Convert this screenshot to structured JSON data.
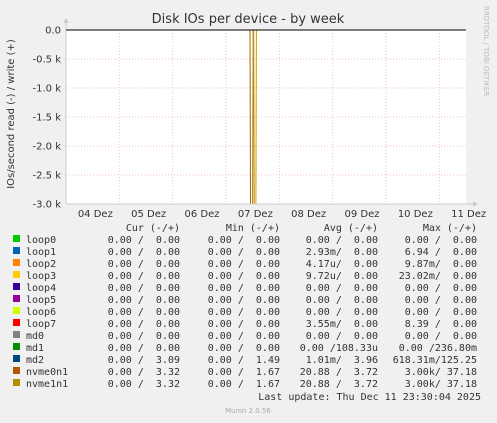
{
  "chart_data": {
    "type": "line",
    "title": "Disk IOs per device - by week",
    "ylabel": "IOs/second read (-) / write (+)",
    "side_label": "RRDTOOL / TOBI OETIKER",
    "ylim": [
      -3.0,
      0.2
    ],
    "yticks": [
      0.0,
      -0.5,
      -1.0,
      -1.5,
      -2.0,
      -2.5,
      -3.0
    ],
    "ytick_labels": [
      "0.0",
      "-0.5 k",
      "-1.0 k",
      "-1.5 k",
      "-2.0 k",
      "-2.5 k",
      "-3.0 k"
    ],
    "yunit": "k",
    "xlim": [
      0,
      7.5
    ],
    "xtick_positions": [
      1,
      2,
      3,
      4,
      5,
      6,
      7
    ],
    "xtick_labels": [
      "04 Dez",
      "05 Dez",
      "06 Dez",
      "07 Dez",
      "08 Dez",
      "09 Dez",
      "10 Dez",
      "11 Dez"
    ],
    "xlabel_days": [
      0.55,
      1.55,
      2.55,
      3.55,
      4.55,
      5.55,
      6.55,
      7.55
    ],
    "grid": true,
    "series": [
      {
        "name": "nvme0n1",
        "color": "#a46400",
        "x": [
          0,
          3.45,
          3.46,
          3.5,
          3.51,
          7.5
        ],
        "y": [
          0,
          0,
          -3.0,
          -3.0,
          0,
          0
        ]
      },
      {
        "name": "nvme1n1",
        "color": "#c8a000",
        "x": [
          0,
          3.52,
          3.53,
          3.56,
          3.57,
          7.5
        ],
        "y": [
          0,
          0,
          -3.0,
          -3.0,
          0,
          0
        ]
      },
      {
        "name": "md2",
        "color": "#000000",
        "x": [
          0,
          7.5
        ],
        "y": [
          0,
          0
        ]
      }
    ],
    "legend_header": {
      "cur": "Cur (-/+)",
      "min": "Min (-/+)",
      "avg": "Avg (-/+)",
      "max": "Max (-/+)"
    },
    "legend": [
      {
        "name": "loop0",
        "color": "#00cc00",
        "cur": "0.00 /  0.00",
        "min": "0.00 /  0.00",
        "avg": "0.00 /  0.00",
        "max": "0.00 /  0.00"
      },
      {
        "name": "loop1",
        "color": "#0066b3",
        "cur": "0.00 /  0.00",
        "min": "0.00 /  0.00",
        "avg": "2.93m/  0.00",
        "max": "6.94 /  0.00"
      },
      {
        "name": "loop2",
        "color": "#ff8000",
        "cur": "0.00 /  0.00",
        "min": "0.00 /  0.00",
        "avg": "4.17u/  0.00",
        "max": "9.87m/  0.00"
      },
      {
        "name": "loop3",
        "color": "#ffcc00",
        "cur": "0.00 /  0.00",
        "min": "0.00 /  0.00",
        "avg": "9.72u/  0.00",
        "max": "23.02m/  0.00"
      },
      {
        "name": "loop4",
        "color": "#330099",
        "cur": "0.00 /  0.00",
        "min": "0.00 /  0.00",
        "avg": "0.00 /  0.00",
        "max": "0.00 /  0.00"
      },
      {
        "name": "loop5",
        "color": "#990099",
        "cur": "0.00 /  0.00",
        "min": "0.00 /  0.00",
        "avg": "0.00 /  0.00",
        "max": "0.00 /  0.00"
      },
      {
        "name": "loop6",
        "color": "#ccff00",
        "cur": "0.00 /  0.00",
        "min": "0.00 /  0.00",
        "avg": "0.00 /  0.00",
        "max": "0.00 /  0.00"
      },
      {
        "name": "loop7",
        "color": "#ff0000",
        "cur": "0.00 /  0.00",
        "min": "0.00 /  0.00",
        "avg": "3.55m/  0.00",
        "max": "8.39 /  0.00"
      },
      {
        "name": "md0",
        "color": "#808080",
        "cur": "0.00 /  0.00",
        "min": "0.00 /  0.00",
        "avg": "0.00 /  0.00",
        "max": "0.00 /  0.00"
      },
      {
        "name": "md1",
        "color": "#008f00",
        "cur": "0.00 /  0.00",
        "min": "0.00 /  0.00",
        "avg": "0.00 /108.33u",
        "max": "0.00 /236.80m"
      },
      {
        "name": "md2",
        "color": "#00487d",
        "cur": "0.00 /  3.09",
        "min": "0.00 /  1.49",
        "avg": "1.01m/  3.96",
        "max": "618.31m/125.25"
      },
      {
        "name": "nvme0n1",
        "color": "#b35a00",
        "cur": "0.00 /  3.32",
        "min": "0.00 /  1.67",
        "avg": "20.88 /  3.72",
        "max": "3.00k/ 37.18"
      },
      {
        "name": "nvme1n1",
        "color": "#b38f00",
        "cur": "0.00 /  3.32",
        "min": "0.00 /  1.67",
        "avg": "20.88 /  3.72",
        "max": "3.00k/ 37.18"
      }
    ],
    "last_update": "Last update: Thu Dec 11 23:30:04 2025",
    "footer": "Munin 2.0.56"
  }
}
